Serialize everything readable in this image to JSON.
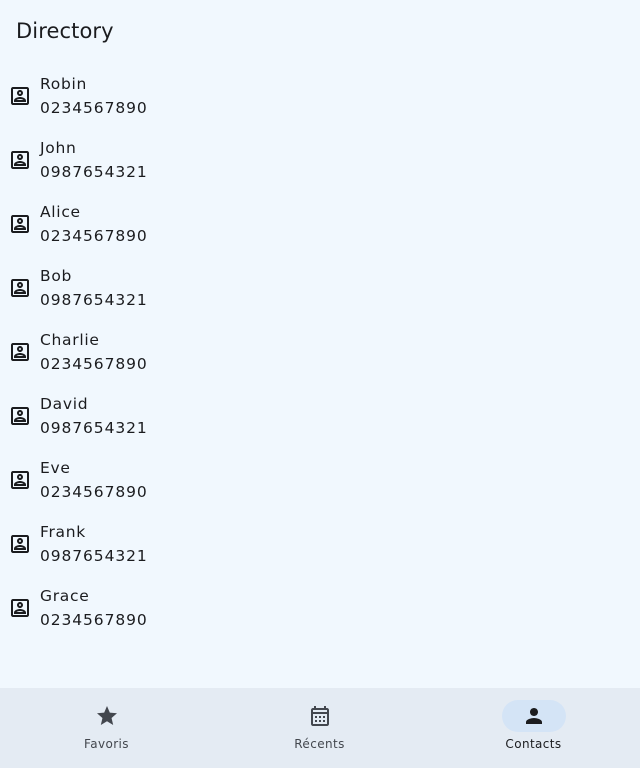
{
  "header": {
    "title": "Directory"
  },
  "contacts": [
    {
      "name": "Robin",
      "phone": "0234567890",
      "icon": "contact-card-icon"
    },
    {
      "name": "John",
      "phone": "0987654321",
      "icon": "contact-card-icon"
    },
    {
      "name": "Alice",
      "phone": "0234567890",
      "icon": "contact-card-icon"
    },
    {
      "name": "Bob",
      "phone": "0987654321",
      "icon": "contact-card-icon"
    },
    {
      "name": "Charlie",
      "phone": "0234567890",
      "icon": "contact-card-icon"
    },
    {
      "name": "David",
      "phone": "0987654321",
      "icon": "contact-card-icon"
    },
    {
      "name": "Eve",
      "phone": "0234567890",
      "icon": "contact-card-icon"
    },
    {
      "name": "Frank",
      "phone": "0987654321",
      "icon": "contact-card-icon"
    },
    {
      "name": "Grace",
      "phone": "0234567890",
      "icon": "contact-card-icon"
    }
  ],
  "bottom_nav": {
    "items": [
      {
        "label": "Favoris",
        "icon": "star-icon",
        "active": false
      },
      {
        "label": "Récents",
        "icon": "calendar-icon",
        "active": false
      },
      {
        "label": "Contacts",
        "icon": "person-icon",
        "active": true
      }
    ],
    "active_indicator_color": "#d4e4f6",
    "background_color": "#e4ebf3"
  },
  "theme": {
    "background_color": "#f1f8fe",
    "text_color": "#1b1c1f"
  }
}
